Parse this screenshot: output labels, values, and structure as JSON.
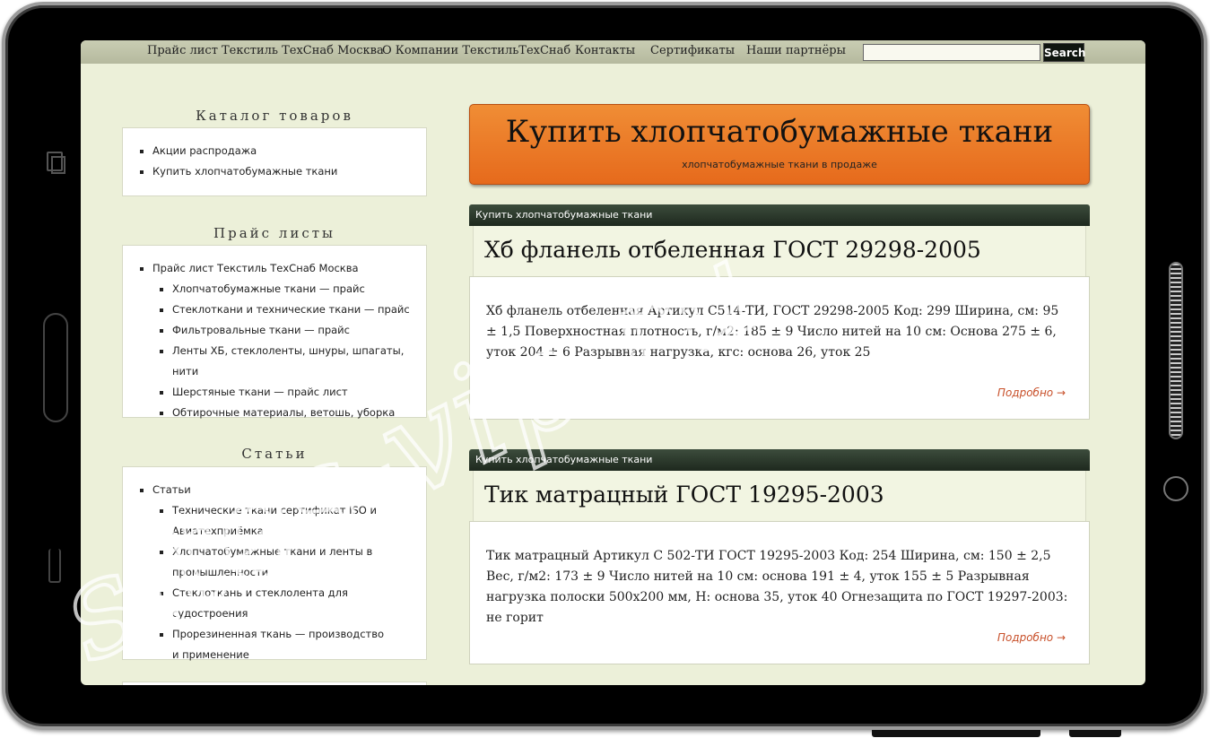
{
  "nav": {
    "items": [
      "Прайс лист Текстиль ТехСнаб Москва",
      "О Компании ТекстильТехСнаб",
      "Контакты",
      "Сертификаты",
      "Наши партнёры"
    ],
    "search_button": "Search"
  },
  "sidebar": {
    "catalog_title": "Каталог товаров",
    "catalog_items": [
      "Акции распродажа",
      "Купить хлопчатобумажные ткани"
    ],
    "price_title": "Прайс листы",
    "price_parent": "Прайс лист Текстиль ТехСнаб Москва",
    "price_children": [
      "Хлопчатобумажные ткани — прайс",
      "Стеклоткани и технические ткани — прайс",
      "Фильтровальные ткани — прайс",
      "Ленты ХБ, стеклоленты, шнуры, шпагаты, нити",
      "Шерстяные ткани — прайс лист",
      "Обтирочные материалы, ветошь, уборка"
    ],
    "articles_title": "Статьи",
    "articles_parent": "Статьи",
    "articles_children": [
      "Технические ткани сертификат ISO и Авиатехприёмка",
      "Хлопчатобумажные ткани и ленты в промышленности",
      "Стеклоткань и стеклолента для судостроения",
      "Прорезиненная ткань — производство и применение"
    ]
  },
  "banner": {
    "title": "Купить хлопчатобумажные ткани",
    "subtitle": "хлопчатобумажные ткани в продаже"
  },
  "posts": [
    {
      "category": "Купить хлопчатобумажные ткани",
      "title": "Хб фланель отбеленная ГОСТ 29298-2005",
      "excerpt": "Хб фланель отбеленная Артикул С514-ТИ, ГОСТ 29298-2005 Код: 299 Ширина, см: 95 ± 1,5 Поверхностная плотность, г/м2: 185 ± 9 Число нитей на 10 см: Основа 275 ± 6, уток 204 ± 6 Разрывная нагрузка, кгс: основа 26, уток 25",
      "more": "Подробно →"
    },
    {
      "category": "Купить хлопчатобумажные ткани",
      "title": "Тик матрацный ГОСТ 19295-2003",
      "excerpt": "Тик матрацный Артикул С 502-ТИ ГОСТ 19295-2003 Код: 254 Ширина, см: 150 ± 2,5 Вес, г/м2: 173 ± 9 Число нитей на 10 см: основа 191 ± 4, уток 155 ± 5 Разрывная нагрузка полоски 500х200 мм, Н: основа 35, уток 40 Огнезащита по ГОСТ 19297-2003: не горит",
      "more": "Подробно →"
    }
  ],
  "watermark": "sites-vip.ru",
  "colors": {
    "screen_bg": "#ecf0d9",
    "banner": "#ee7f2a",
    "category_bar": "#2a362a",
    "link": "#c8502a"
  }
}
